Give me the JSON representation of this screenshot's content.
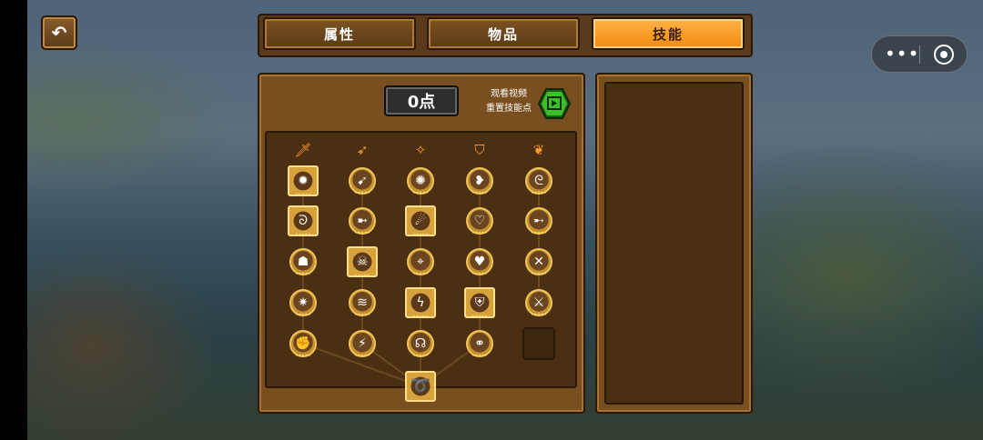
{
  "tabs": [
    {
      "label": "属性",
      "active": false
    },
    {
      "label": "物品",
      "active": false
    },
    {
      "label": "技能",
      "active": true
    }
  ],
  "skill_points": "0点",
  "reset": {
    "line1": "观看视频",
    "line2": "重置技能点"
  },
  "colors": {
    "accent": "#f28a10",
    "panel": "#7a4f1f",
    "tree_bg": "#4a2f12",
    "reset_button": "#3bbf2a"
  },
  "categories": [
    "sword-icon",
    "bow-icon",
    "magic-icon",
    "shield-icon",
    "wing-icon"
  ],
  "skills": [
    [
      "sun-burst-icon",
      "bow-shot-icon",
      "spark-icon",
      "broken-heart-icon",
      "swirl-dragon-icon"
    ],
    [
      "spiral-icon",
      "dash-icon",
      "fireball-icon",
      "no-heart-icon",
      "leaf-blade-icon"
    ],
    [
      "helmet-icon",
      "skull-crossbones-icon",
      "crosshair-icon",
      "heart-bolt-icon",
      "cross-blades-icon"
    ],
    [
      "star-burst-icon",
      "wind-icon",
      "lightning-icon",
      "shield-heart-icon",
      "spartan-helmet-icon"
    ],
    [
      "fist-icon",
      "bolt-dash-icon",
      "headset-icon",
      "triple-ring-icon",
      "empty-slot"
    ]
  ],
  "ultimate": "vortex-icon",
  "glyphs": {
    "sword-icon": "🗡",
    "bow-icon": "➶",
    "magic-icon": "✧",
    "shield-icon": "⛉",
    "wing-icon": "❦",
    "sun-burst-icon": "✹",
    "bow-shot-icon": "➹",
    "spark-icon": "✺",
    "broken-heart-icon": "❥",
    "swirl-dragon-icon": "ᘓ",
    "spiral-icon": "ᘐ",
    "dash-icon": "➼",
    "fireball-icon": "☄",
    "no-heart-icon": "♡",
    "leaf-blade-icon": "➸",
    "helmet-icon": "☗",
    "skull-crossbones-icon": "☠",
    "crosshair-icon": "⌖",
    "heart-bolt-icon": "♥",
    "cross-blades-icon": "✕",
    "star-burst-icon": "✷",
    "wind-icon": "≋",
    "lightning-icon": "ϟ",
    "shield-heart-icon": "⛨",
    "spartan-helmet-icon": "⚔",
    "fist-icon": "✊",
    "bolt-dash-icon": "⚡",
    "headset-icon": "☊",
    "triple-ring-icon": "⚭",
    "vortex-icon": "➰",
    "empty-slot": ""
  },
  "square_nodes": [
    [
      0,
      0
    ],
    [
      1,
      0
    ],
    [
      1,
      2
    ],
    [
      2,
      1
    ],
    [
      3,
      2
    ],
    [
      3,
      3
    ]
  ]
}
